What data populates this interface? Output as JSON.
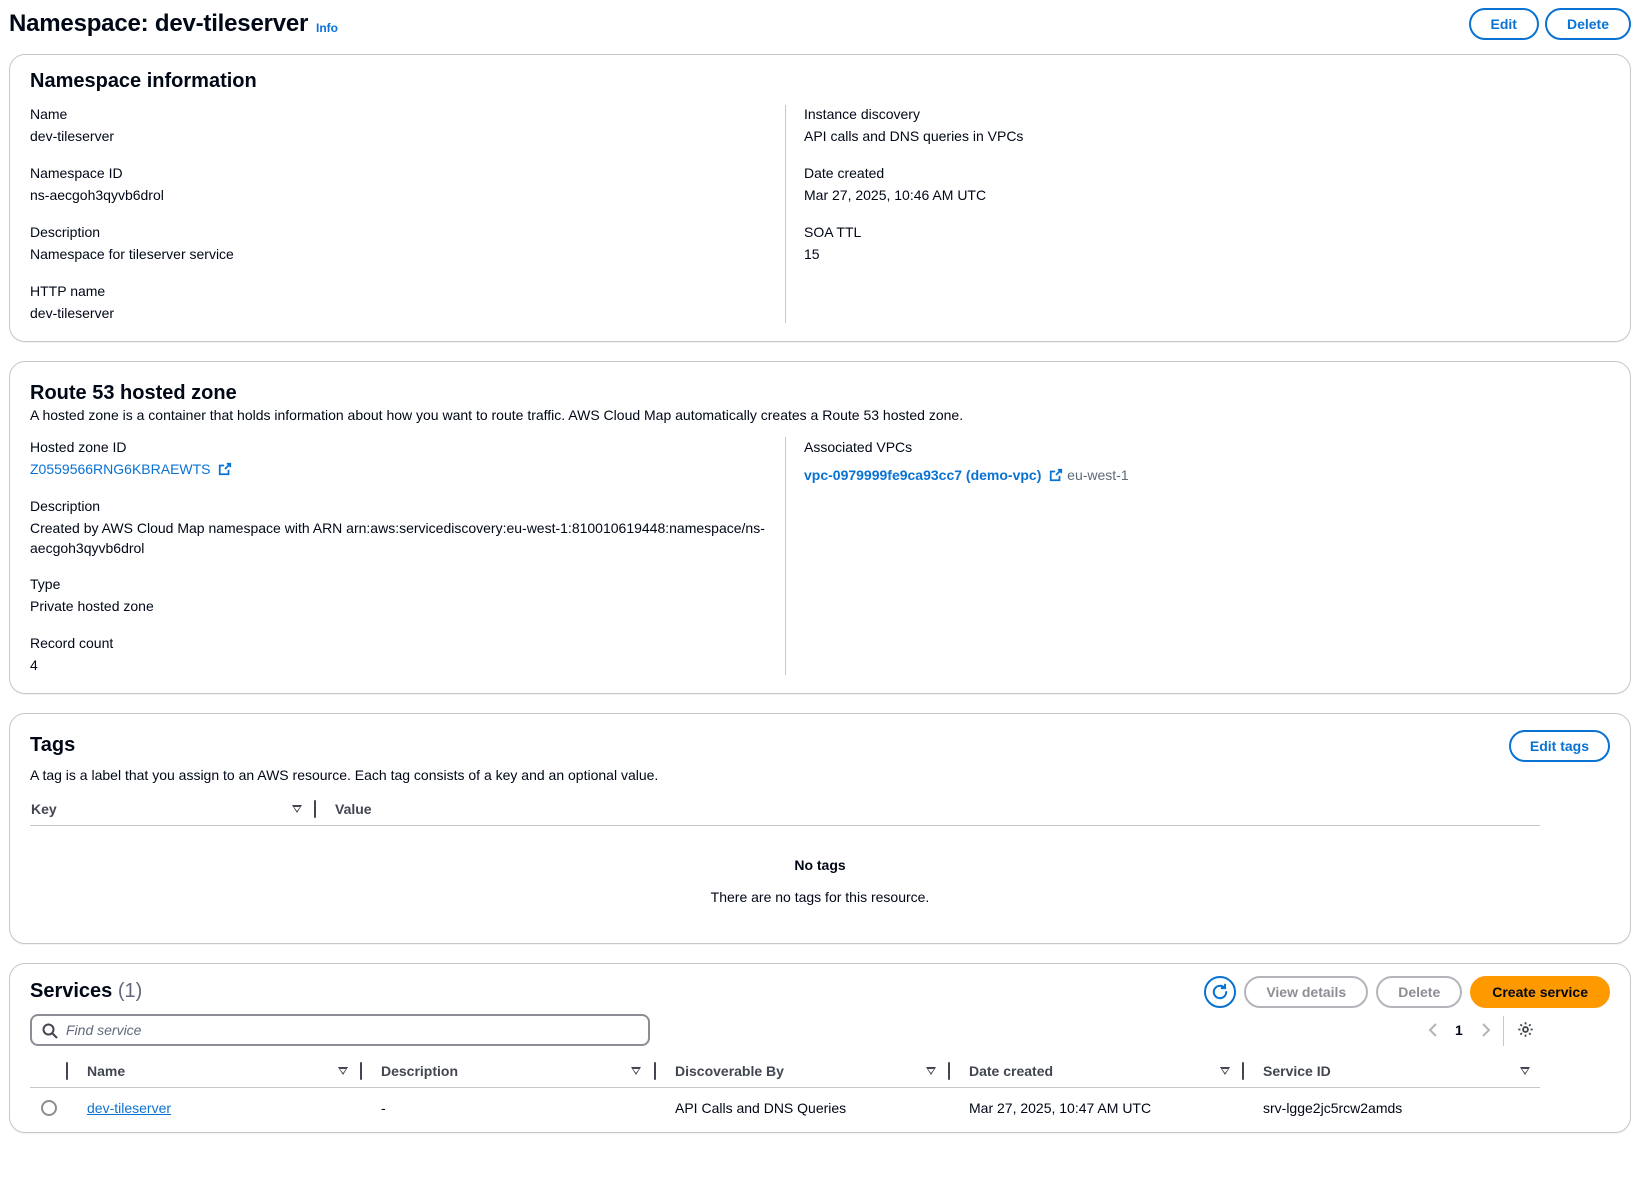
{
  "header": {
    "title": "Namespace: dev-tileserver",
    "info": "Info",
    "edit": "Edit",
    "delete": "Delete"
  },
  "namespace_info": {
    "title": "Namespace information",
    "left": [
      {
        "label": "Name",
        "value": "dev-tileserver"
      },
      {
        "label": "Namespace ID",
        "value": "ns-aecgoh3qyvb6drol"
      },
      {
        "label": "Description",
        "value": "Namespace for tileserver service"
      },
      {
        "label": "HTTP name",
        "value": "dev-tileserver"
      }
    ],
    "right": [
      {
        "label": "Instance discovery",
        "value": "API calls and DNS queries in VPCs"
      },
      {
        "label": "Date created",
        "value": "Mar 27, 2025, 10:46 AM UTC"
      },
      {
        "label": "SOA TTL",
        "value": "15"
      }
    ]
  },
  "hosted_zone": {
    "title": "Route 53 hosted zone",
    "subtitle": "A hosted zone is a container that holds information about how you want to route traffic. AWS Cloud Map automatically creates a Route 53 hosted zone.",
    "zone_id_label": "Hosted zone ID",
    "zone_id": "Z0559566RNG6KBRAEWTS",
    "description_label": "Description",
    "description_line1": "Created by AWS Cloud Map namespace with ARN arn:aws:servicediscovery:eu-west-1:810010619448:namespace/ns-",
    "description_line2": "aecgoh3qyvb6drol",
    "type_label": "Type",
    "type": "Private hosted zone",
    "record_count_label": "Record count",
    "record_count": "4",
    "vpcs_label": "Associated VPCs",
    "vpc_link": "vpc-0979999fe9ca93cc7 (demo-vpc)",
    "vpc_region": "eu-west-1"
  },
  "tags": {
    "title": "Tags",
    "subtitle": "A tag is a label that you assign to an AWS resource. Each tag consists of a key and an optional value.",
    "edit_button": "Edit tags",
    "col_key": "Key",
    "col_value": "Value",
    "empty_title": "No tags",
    "empty_text": "There are no tags for this resource."
  },
  "services": {
    "title": "Services",
    "count": "(1)",
    "view_details": "View details",
    "delete": "Delete",
    "create": "Create service",
    "search_placeholder": "Find service",
    "page": "1",
    "columns": [
      "Name",
      "Description",
      "Discoverable By",
      "Date created",
      "Service ID"
    ],
    "rows": [
      {
        "name": "dev-tileserver",
        "description": "-",
        "discoverable_by": "API Calls and DNS Queries",
        "date_created": "Mar 27, 2025, 10:47 AM UTC",
        "service_id": "srv-lgge2jc5rcw2amds"
      }
    ]
  },
  "colors": {
    "link": "#0972d3",
    "primary": "#ff9900",
    "border": "#c6c6cd"
  }
}
